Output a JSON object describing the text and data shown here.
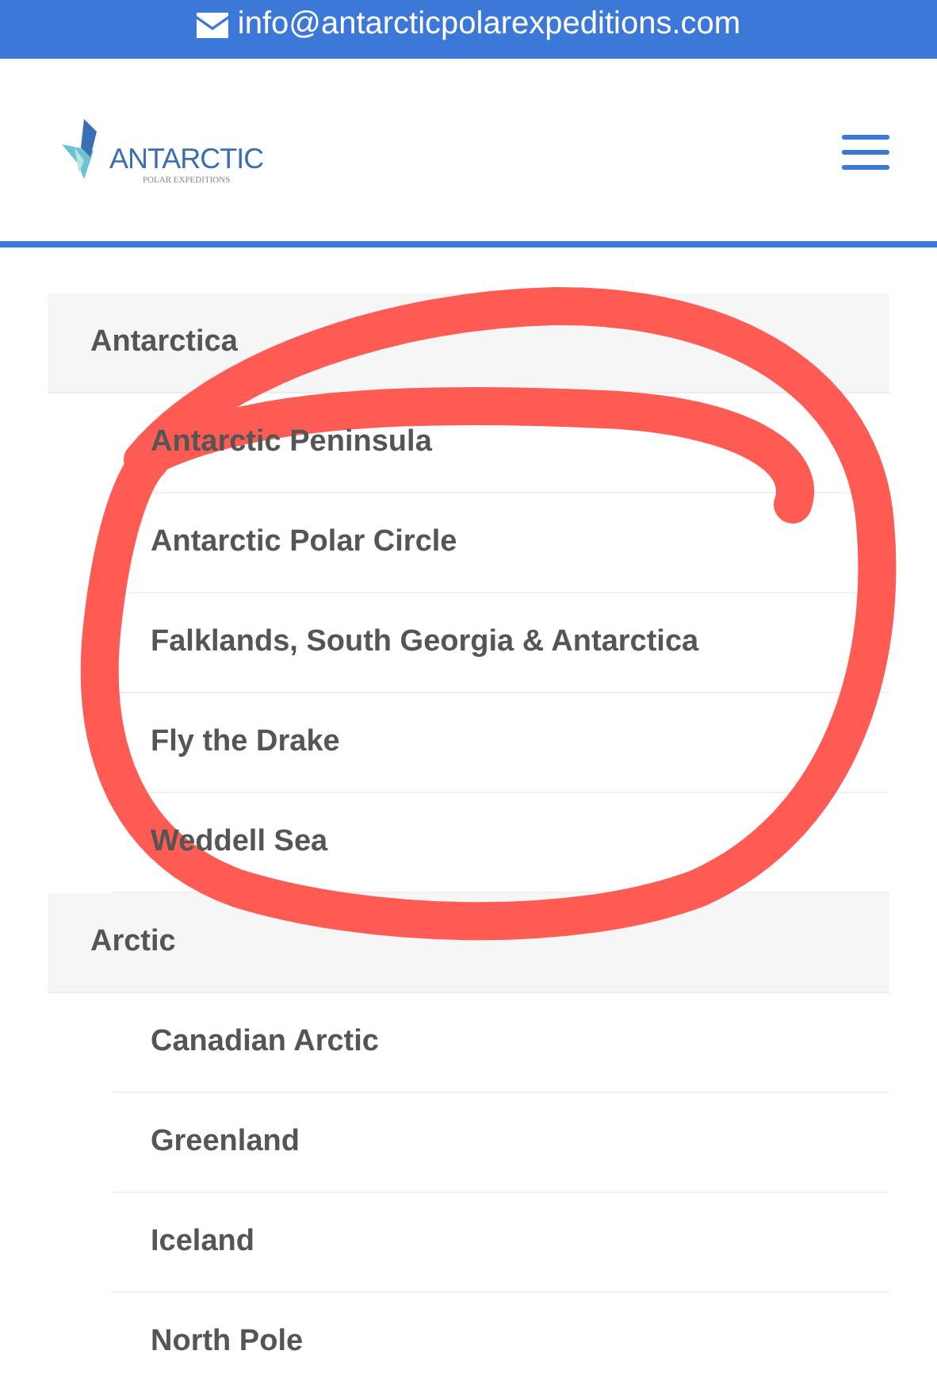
{
  "top_bar": {
    "email": "info@antarcticpolarexpeditions.com"
  },
  "header": {
    "logo": {
      "name": "ANTARCTIC",
      "tagline": "POLAR EXPEDITIONS"
    }
  },
  "menu": [
    {
      "label": "Antarctica",
      "children": [
        {
          "label": "Antarctic Peninsula"
        },
        {
          "label": "Antarctic Polar Circle"
        },
        {
          "label": "Falklands, South Georgia & Antarctica"
        },
        {
          "label": "Fly the Drake"
        },
        {
          "label": "Weddell Sea"
        }
      ]
    },
    {
      "label": "Arctic",
      "children": [
        {
          "label": "Canadian Arctic"
        },
        {
          "label": "Greenland"
        },
        {
          "label": "Iceland"
        },
        {
          "label": "North Pole"
        }
      ]
    }
  ]
}
